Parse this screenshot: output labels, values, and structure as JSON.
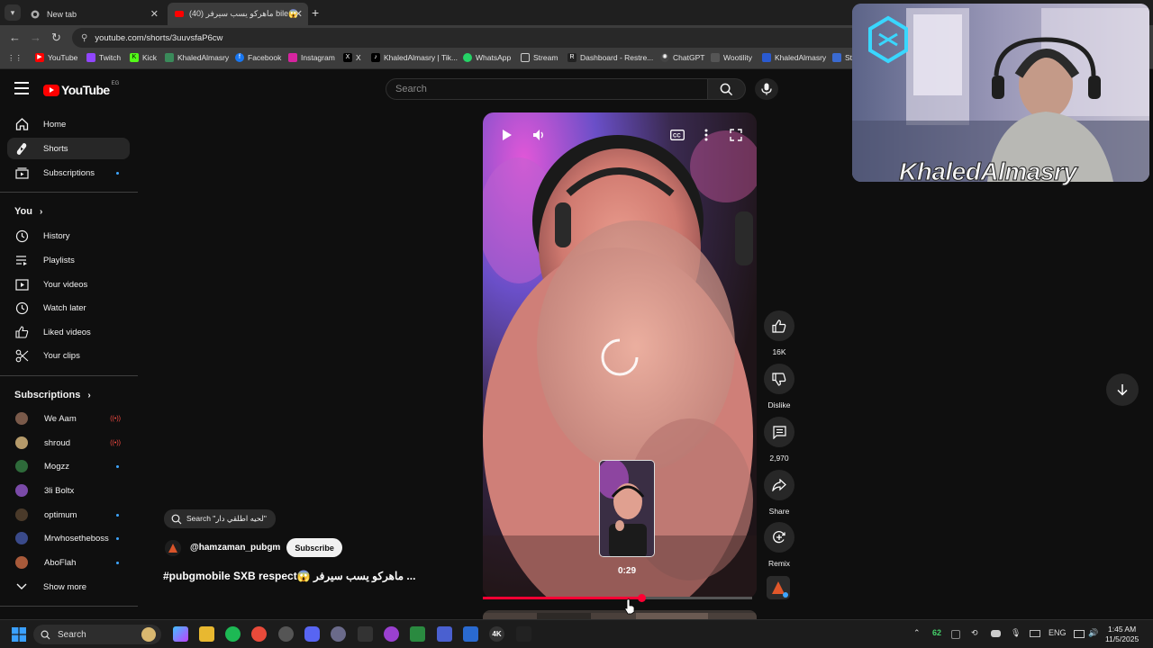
{
  "browser": {
    "tabs": [
      {
        "title": "New tab",
        "active": false
      },
      {
        "title": "ماهركو يسب سيرفر (40) bile😱",
        "active": true
      }
    ],
    "url": "youtube.com/shorts/3uuvsfaP6cw",
    "bookmarks": [
      "YouTube",
      "Twitch",
      "Kick",
      "KhaledAlmasry",
      "Facebook",
      "Instagram",
      "X",
      "KhaledAlmasry | Tik...",
      "WhatsApp",
      "Stream",
      "Dashboard - Restre...",
      "ChatGPT",
      "Wootility",
      "KhaledAlmasry",
      "St"
    ]
  },
  "header": {
    "logo_text": "YouTube",
    "country_code": "EG",
    "search_placeholder": "Search"
  },
  "sidebar": {
    "main": [
      {
        "label": "Home",
        "icon": "home-icon"
      },
      {
        "label": "Shorts",
        "icon": "shorts-icon",
        "active": true
      },
      {
        "label": "Subscriptions",
        "icon": "subscriptions-icon",
        "dot": true
      }
    ],
    "you_heading": "You",
    "you": [
      {
        "label": "History",
        "icon": "history-icon"
      },
      {
        "label": "Playlists",
        "icon": "playlists-icon"
      },
      {
        "label": "Your videos",
        "icon": "your-videos-icon"
      },
      {
        "label": "Watch later",
        "icon": "watch-later-icon"
      },
      {
        "label": "Liked videos",
        "icon": "liked-videos-icon"
      },
      {
        "label": "Your clips",
        "icon": "clips-icon"
      }
    ],
    "subs_heading": "Subscriptions",
    "subs": [
      {
        "label": "We Aam",
        "status": "live",
        "color": "#7a5a4a"
      },
      {
        "label": "shroud",
        "status": "live",
        "color": "#b59a6a"
      },
      {
        "label": "Mogzz",
        "status": "dot",
        "color": "#2e6a3a"
      },
      {
        "label": "3li Boltx",
        "status": "none",
        "color": "#7a4aa8"
      },
      {
        "label": "optimum",
        "status": "dot",
        "color": "#4a3a2a"
      },
      {
        "label": "Mrwhosetheboss",
        "status": "dot",
        "color": "#3a4a8a"
      },
      {
        "label": "AboFlah",
        "status": "dot",
        "color": "#a85a3a"
      }
    ],
    "show_more": "Show more"
  },
  "short": {
    "search_chip": "Search \"لحيه اطلقي دار\"",
    "channel": "@hamzaman_pubgm",
    "subscribe": "Subscribe",
    "title": "#pubgmobile SXB respect😱  ماهركو يسب سيرفر ...",
    "preview_time": "0:29",
    "progress": 0.59
  },
  "actions": {
    "likes": "16K",
    "dislike": "Dislike",
    "comments": "2,970",
    "share": "Share",
    "remix": "Remix"
  },
  "webcam": {
    "name": "KhaledAlmasry"
  },
  "taskbar": {
    "search": "Search",
    "tray_number": "62",
    "lang": "ENG",
    "time": "1:45 AM",
    "date": "11/5/2025"
  },
  "colors": {
    "accent_red": "#ff0033",
    "brand_red": "#ff0000",
    "link_blue": "#3ea6ff",
    "bg": "#0f0f0f"
  }
}
